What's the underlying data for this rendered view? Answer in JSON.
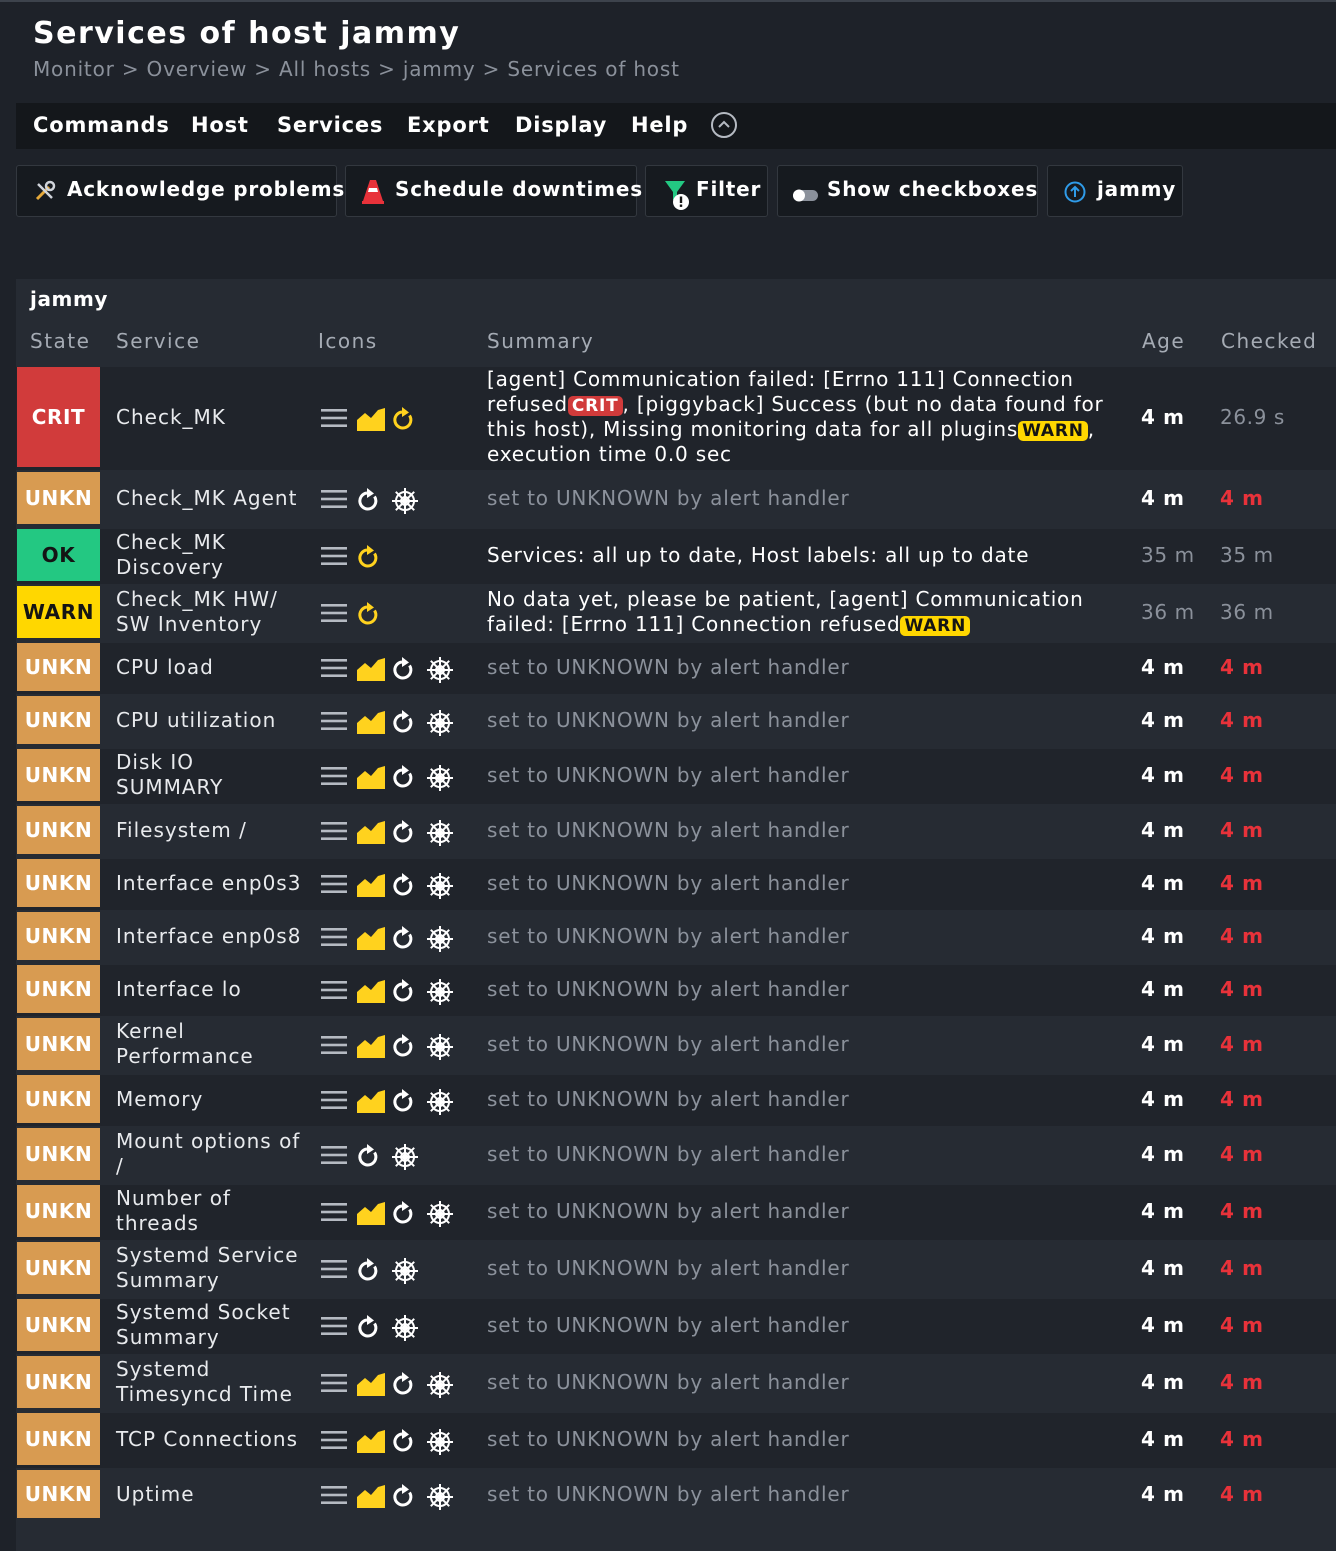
{
  "page": {
    "title": "Services of host jammy",
    "breadcrumb": [
      "Monitor",
      ">",
      "Overview",
      ">",
      "All hosts",
      ">",
      "jammy",
      ">",
      "Services of host"
    ]
  },
  "menu": [
    "Commands",
    "Host",
    "Services",
    "Export",
    "Display",
    "Help"
  ],
  "toolbar": {
    "acknowledge": "Acknowledge problems",
    "downtimes": "Schedule downtimes",
    "filter": "Filter",
    "checkboxes": "Show checkboxes",
    "host": "jammy"
  },
  "table": {
    "group": "jammy",
    "headers": [
      "State",
      "Service",
      "Icons",
      "Summary",
      "Age",
      "Checked"
    ],
    "rows": [
      {
        "state": "CRIT",
        "service": "Check_MK",
        "icons": [
          "menu-icon",
          "perfgraph-icon",
          "reschedule-icon"
        ],
        "summary": [
          "[agent] Communication failed: [Errno 111] Connection refused",
          "CRIT",
          ", [piggyback] Success (but no data found for this host), Missing monitoring data for all plugins",
          "WARN",
          ", execution time 0.0 sec"
        ],
        "age": "4 m",
        "checked": "26.9 s"
      },
      {
        "state": "UNKN",
        "service": "Check_MK Agent",
        "icons": [
          "menu-icon",
          "reschedule-icon",
          "alert-handler-icon"
        ],
        "summary": [
          "set to UNKNOWN by alert handler"
        ],
        "age": "4 m",
        "checked": "4 m"
      },
      {
        "state": "OK",
        "service": "Check_MK Discovery",
        "icons": [
          "menu-icon",
          "reschedule-icon"
        ],
        "summary": [
          "Services: all up to date, Host labels: all up to date"
        ],
        "age": "35 m",
        "checked": "35 m"
      },
      {
        "state": "WARN",
        "service": "Check_MK HW/ SW Inventory",
        "icons": [
          "menu-icon",
          "reschedule-icon"
        ],
        "summary": [
          "No data yet, please be patient, [agent] Communication failed: [Errno 111] Connection refused",
          "WARN"
        ],
        "age": "36 m",
        "checked": "36 m"
      },
      {
        "state": "UNKN",
        "service": "CPU load",
        "icons": [
          "menu-icon",
          "perfgraph-icon",
          "reschedule-icon",
          "alert-handler-icon"
        ],
        "summary": [
          "set to UNKNOWN by alert handler"
        ],
        "age": "4 m",
        "checked": "4 m"
      },
      {
        "state": "UNKN",
        "service": "CPU utilization",
        "icons": [
          "menu-icon",
          "perfgraph-icon",
          "reschedule-icon",
          "alert-handler-icon"
        ],
        "summary": [
          "set to UNKNOWN by alert handler"
        ],
        "age": "4 m",
        "checked": "4 m"
      },
      {
        "state": "UNKN",
        "service": "Disk IO SUMMARY",
        "icons": [
          "menu-icon",
          "perfgraph-icon",
          "reschedule-icon",
          "alert-handler-icon"
        ],
        "summary": [
          "set to UNKNOWN by alert handler"
        ],
        "age": "4 m",
        "checked": "4 m"
      },
      {
        "state": "UNKN",
        "service": "Filesystem /",
        "icons": [
          "menu-icon",
          "perfgraph-icon",
          "reschedule-icon",
          "alert-handler-icon"
        ],
        "summary": [
          "set to UNKNOWN by alert handler"
        ],
        "age": "4 m",
        "checked": "4 m"
      },
      {
        "state": "UNKN",
        "service": "Interface enp0s3",
        "icons": [
          "menu-icon",
          "perfgraph-icon",
          "reschedule-icon",
          "alert-handler-icon"
        ],
        "summary": [
          "set to UNKNOWN by alert handler"
        ],
        "age": "4 m",
        "checked": "4 m"
      },
      {
        "state": "UNKN",
        "service": "Interface enp0s8",
        "icons": [
          "menu-icon",
          "perfgraph-icon",
          "reschedule-icon",
          "alert-handler-icon"
        ],
        "summary": [
          "set to UNKNOWN by alert handler"
        ],
        "age": "4 m",
        "checked": "4 m"
      },
      {
        "state": "UNKN",
        "service": "Interface lo",
        "icons": [
          "menu-icon",
          "perfgraph-icon",
          "reschedule-icon",
          "alert-handler-icon"
        ],
        "summary": [
          "set to UNKNOWN by alert handler"
        ],
        "age": "4 m",
        "checked": "4 m"
      },
      {
        "state": "UNKN",
        "service": "Kernel Performance",
        "icons": [
          "menu-icon",
          "perfgraph-icon",
          "reschedule-icon",
          "alert-handler-icon"
        ],
        "summary": [
          "set to UNKNOWN by alert handler"
        ],
        "age": "4 m",
        "checked": "4 m"
      },
      {
        "state": "UNKN",
        "service": "Memory",
        "icons": [
          "menu-icon",
          "perfgraph-icon",
          "reschedule-icon",
          "alert-handler-icon"
        ],
        "summary": [
          "set to UNKNOWN by alert handler"
        ],
        "age": "4 m",
        "checked": "4 m"
      },
      {
        "state": "UNKN",
        "service": "Mount options of /",
        "icons": [
          "menu-icon",
          "reschedule-icon",
          "alert-handler-icon"
        ],
        "summary": [
          "set to UNKNOWN by alert handler"
        ],
        "age": "4 m",
        "checked": "4 m"
      },
      {
        "state": "UNKN",
        "service": "Number of threads",
        "icons": [
          "menu-icon",
          "perfgraph-icon",
          "reschedule-icon",
          "alert-handler-icon"
        ],
        "summary": [
          "set to UNKNOWN by alert handler"
        ],
        "age": "4 m",
        "checked": "4 m"
      },
      {
        "state": "UNKN",
        "service": "Systemd Service Summary",
        "icons": [
          "menu-icon",
          "reschedule-icon",
          "alert-handler-icon"
        ],
        "summary": [
          "set to UNKNOWN by alert handler"
        ],
        "age": "4 m",
        "checked": "4 m"
      },
      {
        "state": "UNKN",
        "service": "Systemd Socket Summary",
        "icons": [
          "menu-icon",
          "reschedule-icon",
          "alert-handler-icon"
        ],
        "summary": [
          "set to UNKNOWN by alert handler"
        ],
        "age": "4 m",
        "checked": "4 m"
      },
      {
        "state": "UNKN",
        "service": "Systemd Timesyncd Time",
        "icons": [
          "menu-icon",
          "perfgraph-icon",
          "reschedule-icon",
          "alert-handler-icon"
        ],
        "summary": [
          "set to UNKNOWN by alert handler"
        ],
        "age": "4 m",
        "checked": "4 m"
      },
      {
        "state": "UNKN",
        "service": "TCP Connections",
        "icons": [
          "menu-icon",
          "perfgraph-icon",
          "reschedule-icon",
          "alert-handler-icon"
        ],
        "summary": [
          "set to UNKNOWN by alert handler"
        ],
        "age": "4 m",
        "checked": "4 m"
      },
      {
        "state": "UNKN",
        "service": "Uptime",
        "icons": [
          "menu-icon",
          "perfgraph-icon",
          "reschedule-icon",
          "alert-handler-icon"
        ],
        "summary": [
          "set to UNKNOWN by alert handler"
        ],
        "age": "4 m",
        "checked": "4 m"
      }
    ]
  },
  "colors": {
    "crit": "#d13b3b",
    "unkn": "#d89b51",
    "ok": "#23c882",
    "warn": "#ffd700",
    "background": "#1e2229",
    "panel": "#262b33",
    "stale_check": "#e8323a"
  }
}
